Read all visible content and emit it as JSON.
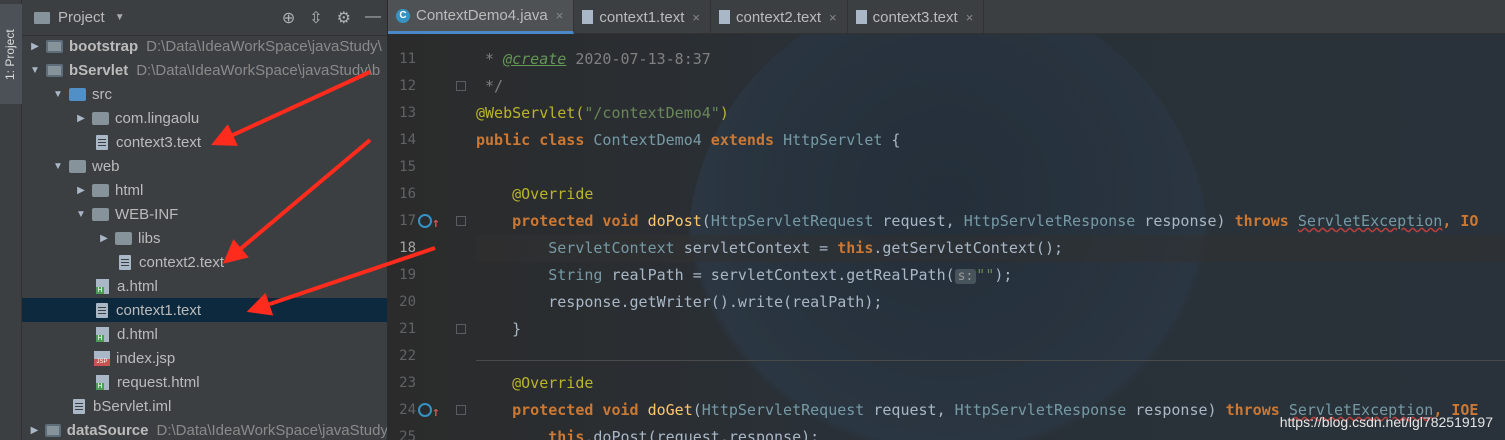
{
  "stripe": {
    "label": "1: Project"
  },
  "project": {
    "title": "Project",
    "tools": [
      "crosshair-icon",
      "collapse-icon",
      "gear-icon",
      "minimize-icon"
    ],
    "tree": [
      {
        "indent": 0,
        "arrow": "▶",
        "icon": "module",
        "label": "bootstrap",
        "path": "D:\\Data\\IdeaWorkSpace\\javaStudy\\",
        "bold": true
      },
      {
        "indent": 0,
        "arrow": "▼",
        "icon": "module",
        "label": "bServlet",
        "path": "D:\\Data\\IdeaWorkSpace\\javaStudy\\b",
        "bold": true
      },
      {
        "indent": 1,
        "arrow": "▼",
        "icon": "src",
        "label": "src"
      },
      {
        "indent": 2,
        "arrow": "▶",
        "icon": "folder",
        "label": "com.lingaolu"
      },
      {
        "indent": 2,
        "arrow": "",
        "icon": "file",
        "label": "context3.text"
      },
      {
        "indent": 1,
        "arrow": "▼",
        "icon": "folder",
        "label": "web"
      },
      {
        "indent": 2,
        "arrow": "▶",
        "icon": "folder",
        "label": "html"
      },
      {
        "indent": 2,
        "arrow": "▼",
        "icon": "folder",
        "label": "WEB-INF"
      },
      {
        "indent": 3,
        "arrow": "▶",
        "icon": "folder",
        "label": "libs"
      },
      {
        "indent": 3,
        "arrow": "",
        "icon": "file",
        "label": "context2.text"
      },
      {
        "indent": 2,
        "arrow": "",
        "icon": "html",
        "label": "a.html"
      },
      {
        "indent": 2,
        "arrow": "",
        "icon": "file",
        "label": "context1.text",
        "selected": true
      },
      {
        "indent": 2,
        "arrow": "",
        "icon": "html",
        "label": "d.html"
      },
      {
        "indent": 2,
        "arrow": "",
        "icon": "jsp",
        "label": "index.jsp"
      },
      {
        "indent": 2,
        "arrow": "",
        "icon": "html",
        "label": "request.html"
      },
      {
        "indent": 1,
        "arrow": "",
        "icon": "file",
        "label": "bServlet.iml"
      },
      {
        "indent": 0,
        "arrow": "▶",
        "icon": "module",
        "label": "dataSource",
        "path": "D:\\Data\\IdeaWorkSpace\\javaStudy",
        "bold": true
      }
    ]
  },
  "tabs": [
    {
      "label": "ContextDemo4.java",
      "type": "java",
      "active": true
    },
    {
      "label": "context1.text",
      "type": "txt"
    },
    {
      "label": "context2.text",
      "type": "txt"
    },
    {
      "label": "context3.text",
      "type": "txt"
    }
  ],
  "editor": {
    "line_numbers": [
      "11",
      "12",
      "13",
      "14",
      "15",
      "16",
      "17",
      "18",
      "19",
      "20",
      "21",
      "22",
      "23",
      "24",
      "25"
    ],
    "current_line": "18",
    "code": {
      "l11_prefix": " * ",
      "l11_tag": "@create",
      "l11_value": " 2020-07-13-8:37",
      "l12": " */",
      "l13_annot": "@WebServlet(",
      "l13_str": "\"/contextDemo4\"",
      "l13_close": ")",
      "l14_kw1": "public class ",
      "l14_name": "ContextDemo4",
      "l14_kw2": " extends ",
      "l14_super": "HttpServlet",
      "l14_brace": " {",
      "l16": "    @Override",
      "l17_kw": "    protected void ",
      "l17_m": "doPost",
      "l17_p1": "(",
      "l17_t1": "HttpServletRequest",
      "l17_a1": " request, ",
      "l17_t2": "HttpServletResponse",
      "l17_a2": " response) ",
      "l17_throws": "throws ",
      "l17_ex": "ServletException",
      "l17_rest": ", IO",
      "l18_t": "        ServletContext",
      "l18_a": " servletContext = ",
      "l18_this": "this",
      "l18_b": ".getServletContext();",
      "l19_t": "        String",
      "l19_a": " realPath = servletContext.getRealPath(",
      "l19_hint": "s:",
      "l19_str": "\"\"",
      "l19_b": ");",
      "l20": "        response.getWriter().write(realPath);",
      "l21": "    }",
      "l23": "    @Override",
      "l24_kw": "    protected void ",
      "l24_m": "doGet",
      "l24_p1": "(",
      "l24_t1": "HttpServletRequest",
      "l24_a1": " request, ",
      "l24_t2": "HttpServletResponse",
      "l24_a2": " response) ",
      "l24_throws": "throws ",
      "l24_ex": "ServletException",
      "l24_rest": ", IOE",
      "l25_this": "        this",
      "l25_b": ".doPost(request,response);"
    }
  },
  "watermark": "https://blog.csdn.net/lgl782519197"
}
